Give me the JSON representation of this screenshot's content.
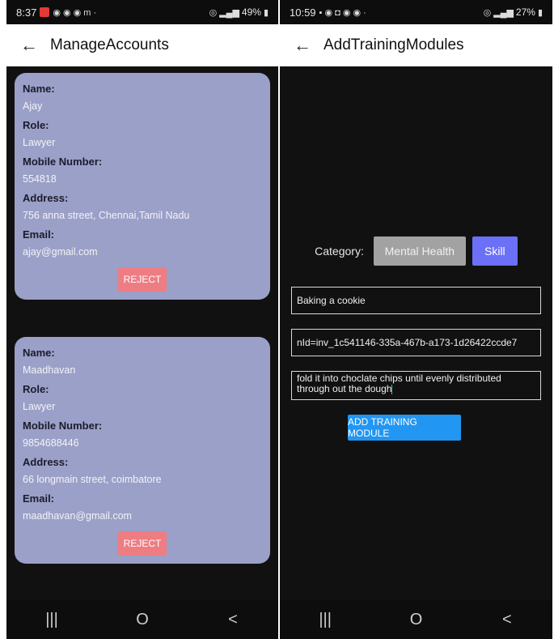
{
  "left": {
    "status": {
      "time": "8:37",
      "battery": "49%"
    },
    "title": "ManageAccounts",
    "cards": [
      {
        "name_label": "Name:",
        "name": "Ajay",
        "role_label": "Role:",
        "role": "Lawyer",
        "mobile_label": "Mobile Number:",
        "mobile": "554818",
        "address_label": "Address:",
        "address": "756 anna street, Chennai,Tamil Nadu",
        "email_label": "Email:",
        "email": "ajay@gmail.com",
        "reject_label": "REJECT"
      },
      {
        "name_label": "Name:",
        "name": "Maadhavan",
        "role_label": "Role:",
        "role": "Lawyer",
        "mobile_label": "Mobile Number:",
        "mobile": "9854688446",
        "address_label": "Address:",
        "address": "66 longmain street, coimbatore",
        "email_label": "Email:",
        "email": "maadhavan@gmail.com",
        "reject_label": "REJECT"
      }
    ]
  },
  "right": {
    "status": {
      "time": "10:59",
      "battery": "27%"
    },
    "title": "AddTrainingModules",
    "category_label": "Category:",
    "category_options": [
      "Mental Health",
      "Skill"
    ],
    "module_title": "Baking a cookie",
    "nid": "nId=inv_1c541146-335a-467b-a173-1d26422ccde7",
    "description_line1": "fold it into choclate chips until evenly distributed",
    "description_line2": "through out the dough",
    "add_button": "ADD TRAINING MODULE"
  },
  "nav": {
    "recents": "|||",
    "home": "O",
    "back": "<"
  },
  "icons": [
    "back-arrow-icon",
    "wifi-icon",
    "signal-icon",
    "battery-icon"
  ],
  "colors": {
    "card": "#9aa0c8",
    "reject": "#ee7d83",
    "skill": "#6b70f7",
    "add": "#2196f3",
    "mental": "#a2a2a2"
  }
}
